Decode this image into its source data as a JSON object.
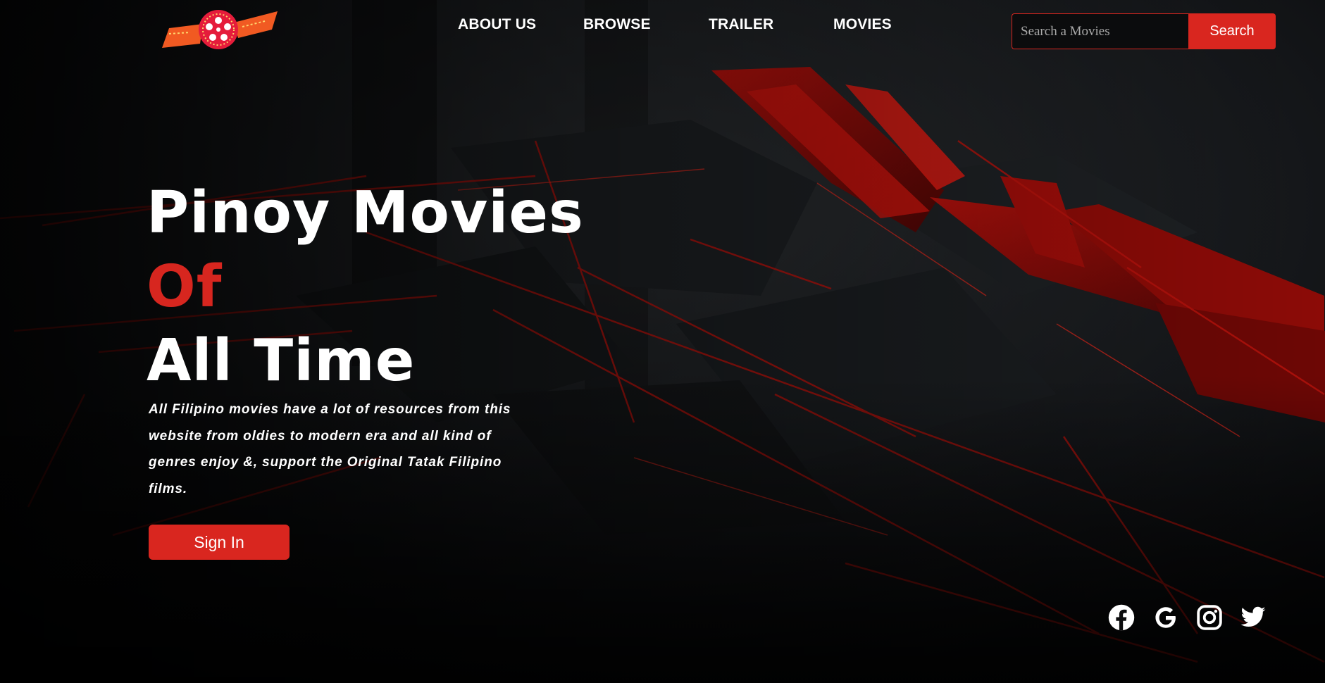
{
  "nav": {
    "items": [
      {
        "label": "ABOUT US"
      },
      {
        "label": "BROWSE"
      },
      {
        "label": "TRAILER"
      },
      {
        "label": "MOVIES"
      }
    ]
  },
  "search": {
    "placeholder": "Search a Movies",
    "button_label": "Search"
  },
  "hero": {
    "title_line1": "Pinoy Movies",
    "title_line2": "Of",
    "title_line3": "All Time",
    "description": "All Filipino movies have a lot of resources from this website from oldies to modern era and all kind of genres enjoy &, support the Original Tatak Filipino films.",
    "signin_label": "Sign In"
  },
  "social": {
    "icons": [
      "facebook-icon",
      "google-icon",
      "instagram-icon",
      "twitter-icon"
    ]
  },
  "colors": {
    "accent": "#d9261f",
    "background": "#0a0b0c",
    "text": "#ffffff"
  }
}
